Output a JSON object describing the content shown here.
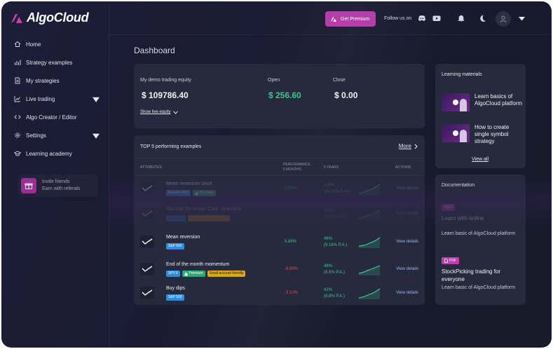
{
  "brand": {
    "name": "AlgoCloud"
  },
  "sidebar": {
    "items": [
      {
        "label": "Home",
        "icon": "home-icon",
        "has_caret": false
      },
      {
        "label": "Strategy examples",
        "icon": "bar-chart-icon",
        "has_caret": false
      },
      {
        "label": "My strategies",
        "icon": "document-icon",
        "has_caret": false
      },
      {
        "label": "Live trading",
        "icon": "line-chart-icon",
        "has_caret": true
      },
      {
        "label": "Algo Creator / Editor",
        "icon": "code-icon",
        "has_caret": false
      },
      {
        "label": "Settings",
        "icon": "gear-icon",
        "has_caret": true
      },
      {
        "label": "Learning academy",
        "icon": "graduation-cap-icon",
        "has_caret": false
      }
    ],
    "invite": {
      "line1": "Invite friends",
      "line2": "Earn with referals"
    }
  },
  "topbar": {
    "premium_label": "Get Premium",
    "follow_label": "Follow us on"
  },
  "main": {
    "title": "Dashboard",
    "equity": {
      "label": "My demo trading equity",
      "value": "$ 109786.40",
      "open_label": "Open",
      "open_value": "$ 256.60",
      "close_label": "Close",
      "close_value": "$ 0.00",
      "show_link": "Show live equity"
    },
    "top5": {
      "title": "TOP 5 performing examples",
      "more": "More",
      "headers": {
        "attributes": "ATTRIBUTES",
        "performance_line1": "PERFORMANCE",
        "performance_line2": "6 MONTHS",
        "five_years": "5 YEARS",
        "actions": "ACTIONS"
      },
      "rows": [
        {
          "name": "Mean reversion short",
          "tags": [
            {
              "text": "Russell 2000",
              "color": "blue"
            },
            {
              "text": "Premium",
              "color": "green",
              "lock": true
            }
          ],
          "perf": "5.3R%",
          "perf_sign": "pos",
          "fy1": "100%",
          "fy2": "(25.08% P.A.)",
          "view": "View details",
          "style": "dim"
        },
        {
          "name": "Monster Beverage Corp. Seasonal",
          "tags": [
            {
              "text": "",
              "color": "blue"
            },
            {
              "text": "",
              "color": "yellow"
            }
          ],
          "perf": "",
          "perf_sign": "pos",
          "fy1": "4R%",
          "fy2": "(8.8% P.A.)",
          "view": "View details",
          "style": "blur"
        },
        {
          "name": "Mean reversion",
          "tags": [
            {
              "text": "S&P 500",
              "color": "blue"
            }
          ],
          "perf": "5.88%",
          "perf_sign": "pos",
          "fy1": "46%",
          "fy2": "(9.16% P.A.)",
          "view": "View details",
          "style": "normal"
        },
        {
          "name": "End of the month momentum",
          "tags": [
            {
              "text": "SPY.0",
              "color": "blue"
            },
            {
              "text": "Premium",
              "color": "green",
              "lock": true
            },
            {
              "text": "Small account friendly",
              "color": "yellow"
            }
          ],
          "perf": "-6.95%",
          "perf_sign": "neg",
          "fy1": "48%",
          "fy2": "(8.5% P.A.)",
          "view": "View details",
          "style": "normal"
        },
        {
          "name": "Buy dips",
          "tags": [
            {
              "text": "S&P 500",
              "color": "blue"
            }
          ],
          "perf": "-3.10%",
          "perf_sign": "neg",
          "fy1": "42%",
          "fy2": "(8.8% P.A.)",
          "view": "View details",
          "style": "normal"
        }
      ]
    }
  },
  "learning": {
    "title": "Learning materials",
    "items": [
      {
        "text": "Learn basics of AlgoCloud platform"
      },
      {
        "text": "How to create single symbol strategy"
      }
    ],
    "view_all": "View all"
  },
  "documentation": {
    "title": "Documentation",
    "items": [
      {
        "badge": "WEB",
        "title": "Learn with online",
        "sub": "Learn basic of AlgoCloud platform",
        "faded": true
      },
      {
        "badge": "PDF",
        "title": "StockPicking trading for everyone",
        "sub": "Learn basic of AlgoCloud platform",
        "faded": false
      }
    ]
  },
  "colors": {
    "accent": "#b43fa9",
    "positive": "#3cc48f",
    "negative": "#e0454b",
    "tag_blue": "#2a8fe0",
    "tag_yellow": "#e0a51c"
  }
}
